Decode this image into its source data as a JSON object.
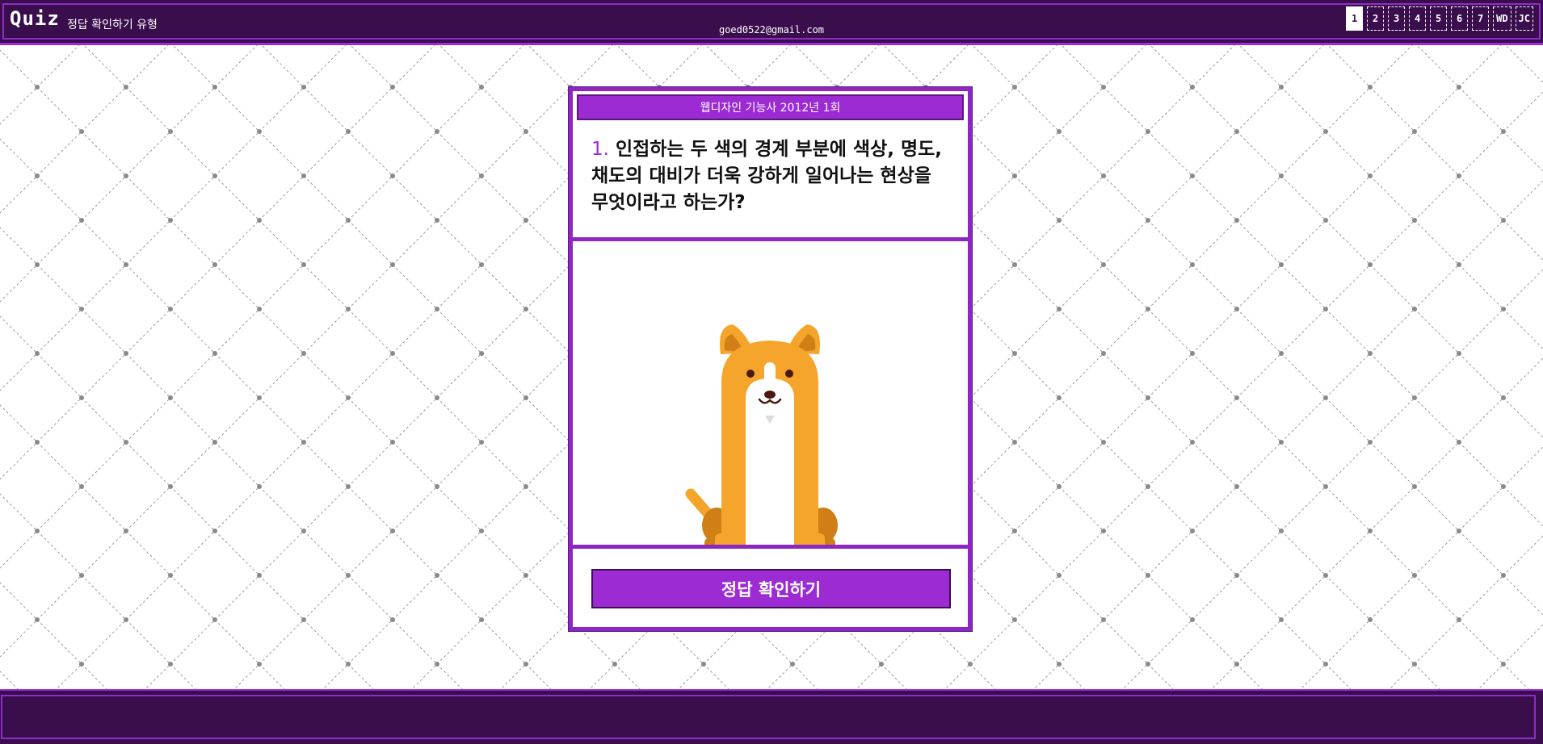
{
  "header": {
    "logo": "Quiz",
    "subtitle": "정답 확인하기 유형",
    "pages": [
      "1",
      "2",
      "3",
      "4",
      "5",
      "6",
      "7",
      "WD",
      "JC"
    ],
    "active_page": "1"
  },
  "card": {
    "title": "웹디자인 기능사 2012년 1회",
    "question_number": "1.",
    "question_text": " 인접하는 두 색의 경계 부분에 색상, 명도, 채도의 대비가 더욱 강하게 일어나는 현상을 무엇이라고 하는가?",
    "illustration": "dog-illustration",
    "answer_button": "정답 확인하기"
  },
  "footer": {
    "email": "goed0522@gmail.com"
  },
  "colors": {
    "header_bg": "#3a0e4c",
    "accent": "#9d2bd4",
    "dog_orange": "#f5a52b",
    "dog_dark": "#d07f17"
  }
}
